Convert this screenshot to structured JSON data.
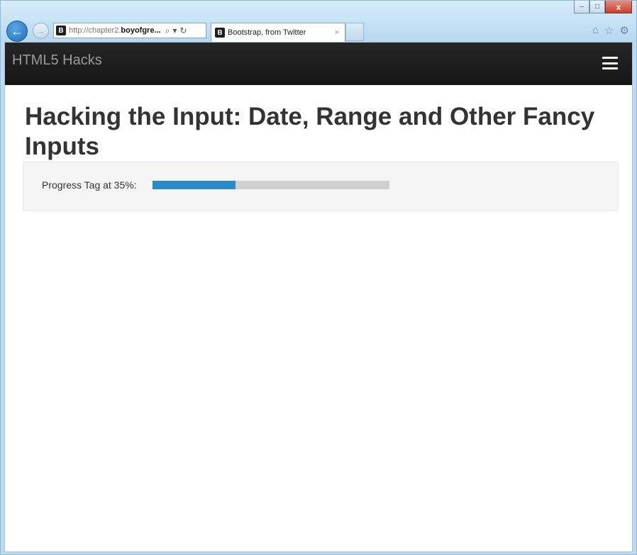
{
  "browser": {
    "address": {
      "favicon": "B",
      "prefix": "http://chapter2.",
      "domain": "boyofgre...",
      "search_glyph": "⌕",
      "dropdown_glyph": "▾",
      "refresh_glyph": "↻"
    },
    "tab": {
      "favicon": "B",
      "title": "Bootstrap, from Twitter",
      "close_glyph": "×"
    },
    "window_controls": {
      "minimize": "–",
      "maximize": "□",
      "close": "x"
    },
    "icons": [
      "back-icon",
      "forward-icon",
      "home-icon",
      "favorites-star-icon",
      "settings-gear-icon"
    ],
    "right_glyphs": {
      "home": "⌂",
      "star": "☆",
      "gear": "⚙"
    },
    "back_glyph": "←",
    "forward_glyph": "→"
  },
  "navbar": {
    "brand": "HTML5 Hacks",
    "background": "#1b1b1b"
  },
  "main": {
    "heading": "Hacking the Input: Date, Range and Other Fancy Inputs",
    "progress": {
      "label": "Progress Tag at 35%:",
      "value": 0.35,
      "fill_color": "#2a8bcb",
      "track_color": "#d0d0d0"
    }
  }
}
